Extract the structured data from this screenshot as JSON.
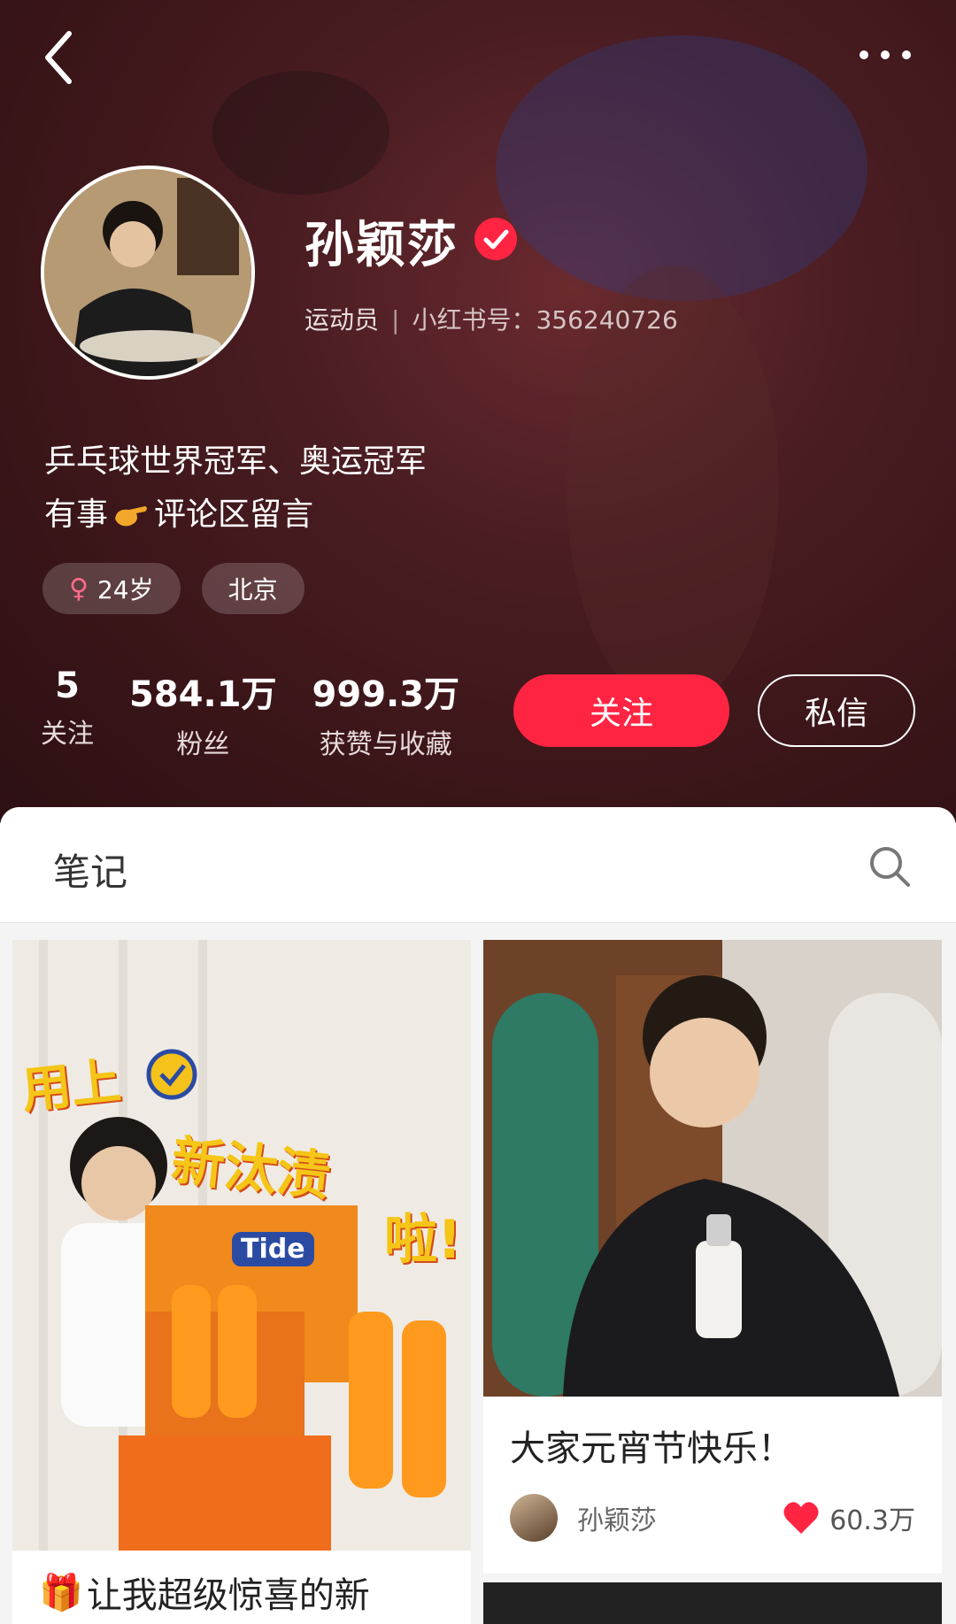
{
  "header": {
    "back_label": "",
    "more_label": ""
  },
  "profile": {
    "name": "孙颖莎",
    "role": "运动员",
    "separator": "|",
    "id_text": "小红书号：356240726",
    "bio_line1": "乒乓球世界冠军、奥运冠军",
    "bio_line2_prefix": "有事",
    "bio_line2_suffix": "评论区留言",
    "tags": [
      {
        "label": "24岁",
        "icon": "female-icon"
      },
      {
        "label": "北京"
      }
    ],
    "stats": [
      {
        "num": "5",
        "label": "关注"
      },
      {
        "num": "584.1万",
        "label": "粉丝"
      },
      {
        "num": "999.3万",
        "label": "获赞与收藏"
      }
    ],
    "follow_label": "关注",
    "message_label": "私信"
  },
  "notes": {
    "tab_title": "笔记",
    "cards": [
      {
        "title": "让我超级惊喜的新",
        "cover_text": [
          "用上",
          "新汰渍",
          "啦!"
        ],
        "brand": "Tide"
      },
      {
        "title": "大家元宵节快乐！",
        "author": "孙颖莎",
        "likes": "60.3万"
      }
    ]
  },
  "colors": {
    "accent": "#ff2442",
    "hero_bg": "#3a1518"
  }
}
